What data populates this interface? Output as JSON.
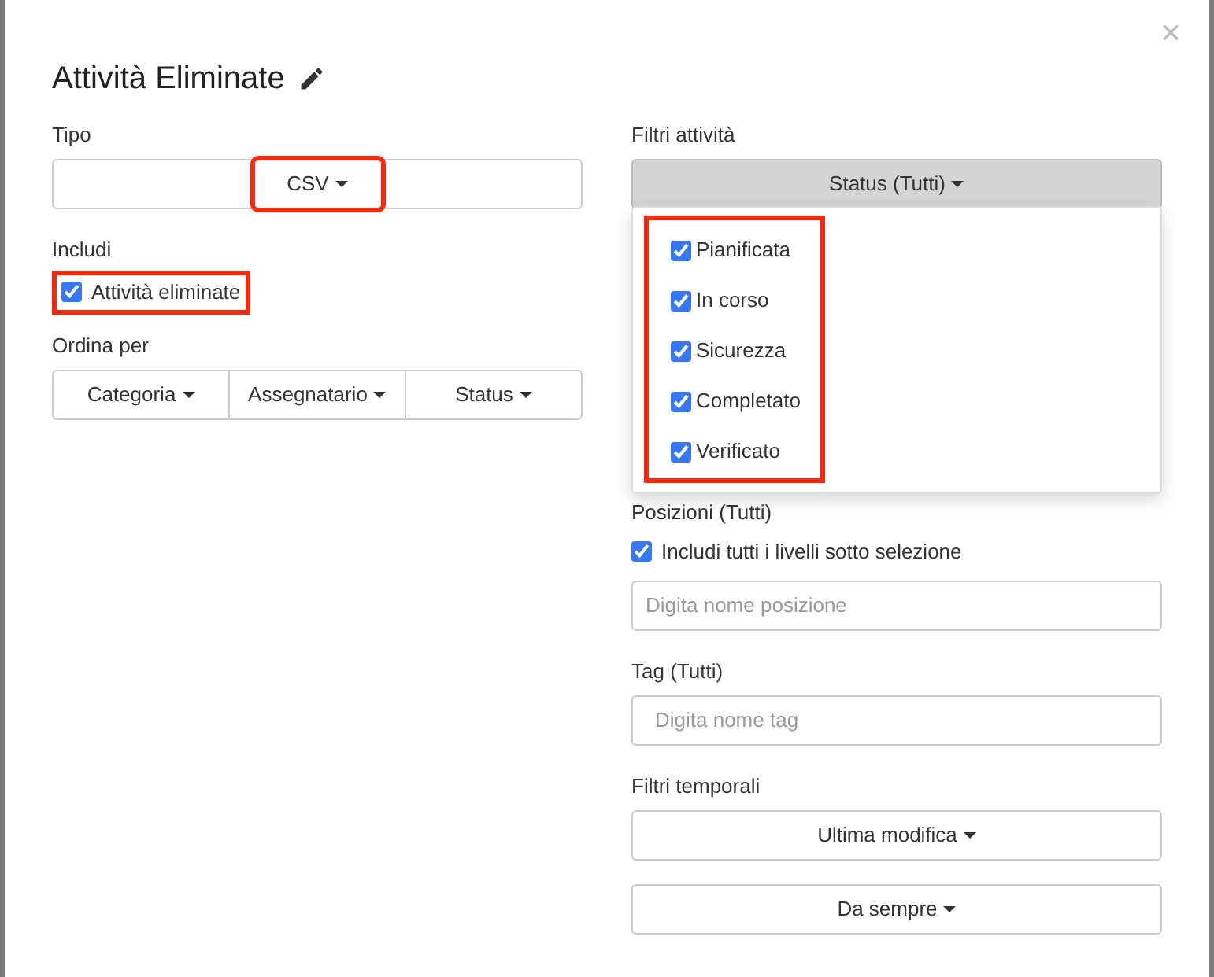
{
  "modal": {
    "title": "Attività Eliminate",
    "close": "×"
  },
  "left": {
    "type_label": "Tipo",
    "type_button": {
      "label": "CSV",
      "highlighted": true
    },
    "include_label": "Includi",
    "include_option": {
      "label": "Attività eliminate",
      "checked": true,
      "highlighted": true
    },
    "sort_label": "Ordina per",
    "sort_buttons": [
      "Categoria",
      "Assegnatario",
      "Status"
    ]
  },
  "right": {
    "filters_label": "Filtri attività",
    "status_button": {
      "label": "Status (Tutti)",
      "expanded": true
    },
    "status_menu": {
      "highlighted": true,
      "items": [
        {
          "label": "Pianificata",
          "checked": true
        },
        {
          "label": "In corso",
          "checked": true
        },
        {
          "label": "Sicurezza",
          "checked": true
        },
        {
          "label": "Completato",
          "checked": true
        },
        {
          "label": "Verificato",
          "checked": true
        }
      ]
    },
    "positions_label": "Posizioni (Tutti)",
    "positions_option": {
      "label": "Includi tutti i livelli sotto selezione",
      "checked": true
    },
    "positions_field": {
      "placeholder": "Digita nome posizione"
    },
    "tag_label": "Tag (Tutti)",
    "tag_field": {
      "placeholder": "Digita nome tag"
    },
    "time_label": "Filtri temporali",
    "time_buttons": [
      "Ultima modifica",
      "Da sempre"
    ]
  }
}
